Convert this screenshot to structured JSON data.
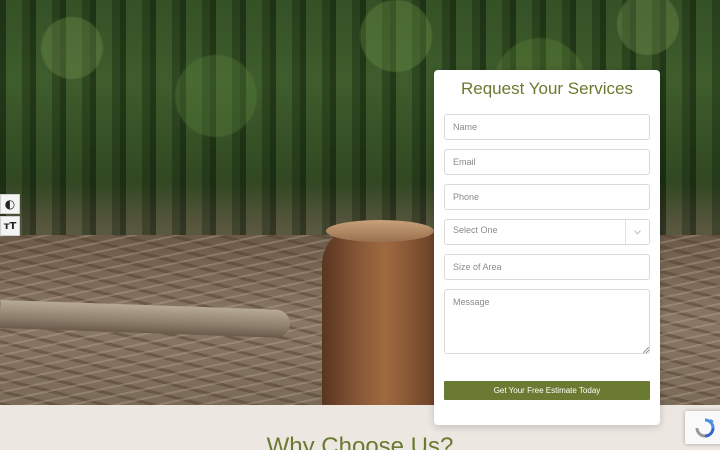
{
  "form": {
    "title": "Request Your Services",
    "name_placeholder": "Name",
    "email_placeholder": "Email",
    "phone_placeholder": "Phone",
    "select_value": "Select One",
    "area_placeholder": "Size of Area",
    "message_placeholder": "Message",
    "submit_label": "Get Your Free Estimate Today"
  },
  "section": {
    "heading": "Why Choose Us?"
  },
  "accessibility": {
    "contrast_icon": "contrast-icon",
    "font_size_icon": "font-size-icon",
    "contrast_glyph": "◐",
    "font_size_glyph": "ᴛT"
  },
  "icons": {
    "select_arrow": "chevron-down-icon",
    "recaptcha": "recaptcha-icon"
  },
  "colors": {
    "accent": "#6b7a32",
    "background": "#ede7e1",
    "card": "#ffffff"
  }
}
